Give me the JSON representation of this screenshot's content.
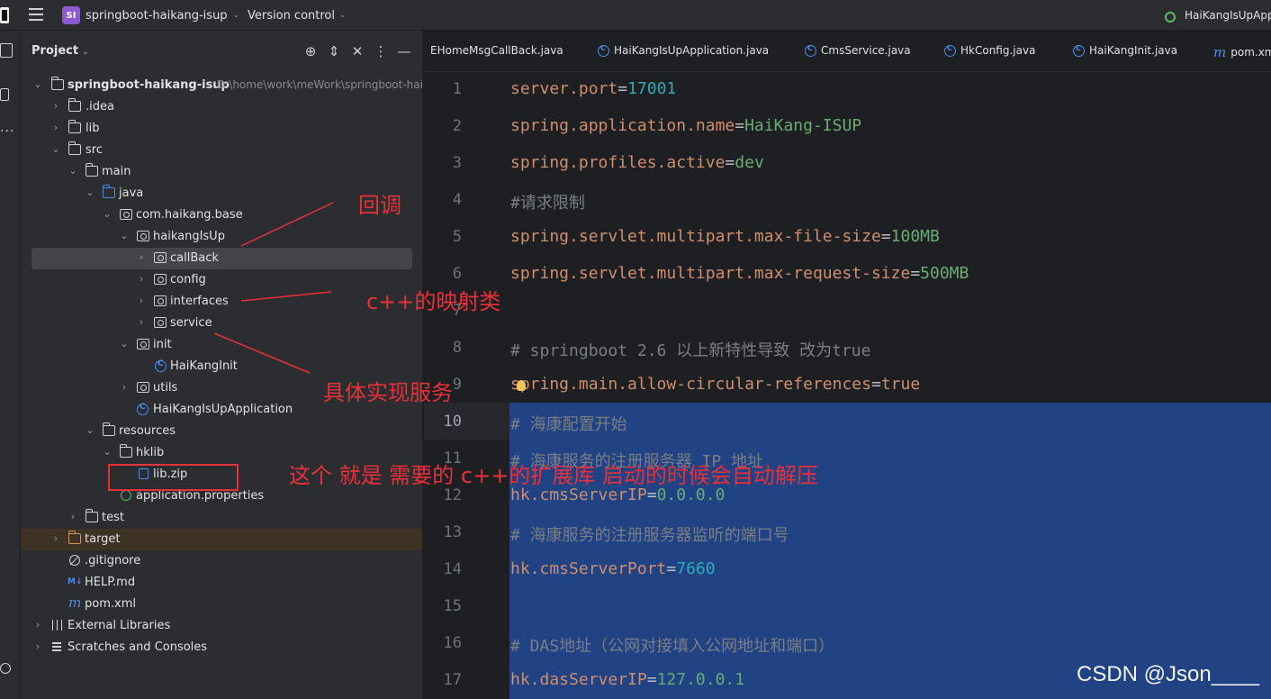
{
  "titlebar": {
    "project_badge": "SI",
    "project_name": "springboot-haikang-isup",
    "version_control": "Version control",
    "run_config": "HaiKangIsUpApp"
  },
  "project_panel": {
    "title": "Project",
    "tree": [
      {
        "label": "springboot-haikang-isup",
        "path": "D:\\home\\work\\meWork\\springboot-haik",
        "bold": true
      },
      {
        "label": ".idea"
      },
      {
        "label": "lib"
      },
      {
        "label": "src"
      },
      {
        "label": "main"
      },
      {
        "label": "java"
      },
      {
        "label": "com.haikang.base"
      },
      {
        "label": "haikangIsUp"
      },
      {
        "label": "callBack"
      },
      {
        "label": "config"
      },
      {
        "label": "interfaces"
      },
      {
        "label": "service"
      },
      {
        "label": "init"
      },
      {
        "label": "HaiKangInit"
      },
      {
        "label": "utils"
      },
      {
        "label": "HaiKangIsUpApplication"
      },
      {
        "label": "resources"
      },
      {
        "label": "hklib"
      },
      {
        "label": "lib.zip"
      },
      {
        "label": "application.properties"
      },
      {
        "label": "test"
      },
      {
        "label": "target"
      },
      {
        "label": ".gitignore"
      },
      {
        "label": "HELP.md"
      },
      {
        "label": "pom.xml"
      },
      {
        "label": "External Libraries"
      },
      {
        "label": "Scratches and Consoles"
      }
    ]
  },
  "editor": {
    "tabs": [
      {
        "label": "EHomeMsgCallBack.java"
      },
      {
        "label": "HaiKangIsUpApplication.java"
      },
      {
        "label": "CmsService.java"
      },
      {
        "label": "HkConfig.java"
      },
      {
        "label": "HaiKangInit.java"
      },
      {
        "label": "pom.xml"
      }
    ],
    "line_numbers": [
      "1",
      "2",
      "3",
      "4",
      "5",
      "6",
      "7",
      "8",
      "9",
      "10",
      "11",
      "12",
      "13",
      "14",
      "15",
      "16",
      "17"
    ],
    "code": {
      "l1_key": "server.port",
      "l1_val": "17001",
      "l2_key": "spring.application.name",
      "l2_val": "HaiKang-ISUP",
      "l3_key": "spring.profiles.active",
      "l3_val": "dev",
      "l4_comment": "#请求限制",
      "l5_key": "spring.servlet.multipart.max-file-size",
      "l5_val": "100MB",
      "l6_key": "spring.servlet.multipart.max-request-size",
      "l6_val": "500MB",
      "l8_comment": "# springboot 2.6 以上新特性导致 改为true",
      "l9_key": "spring.main.allow-circular-references",
      "l9_val": "true",
      "l10_comment": "# 海康配置开始",
      "l11_comment": "# 海康服务的注册服务器 IP 地址",
      "l12_key": "hk.cmsServerIP",
      "l12_val": "0.0.0.0",
      "l13_comment": "# 海康服务的注册服务器监听的端口号",
      "l14_key": "hk.cmsServerPort",
      "l14_val": "7660",
      "l16_comment": "# DAS地址（公网对接填入公网地址和端口）",
      "l17_key": "hk.dasServerIP",
      "l17_val": "127.0.0.1",
      "equals": "="
    }
  },
  "annotations": {
    "callback": "回调",
    "interfaces": "c++的映射类",
    "service": "具体实现服务",
    "libzip": "这个 就是 需要的 c++的扩展库 启动的时候会自动解压"
  },
  "watermark": "CSDN @Json____",
  "colors": {
    "annotation": "#e8303a",
    "selection": "#214283",
    "key": "#cf8e6d",
    "number": "#2aacb8",
    "string": "#6aab73",
    "comment": "#7a7e85"
  }
}
